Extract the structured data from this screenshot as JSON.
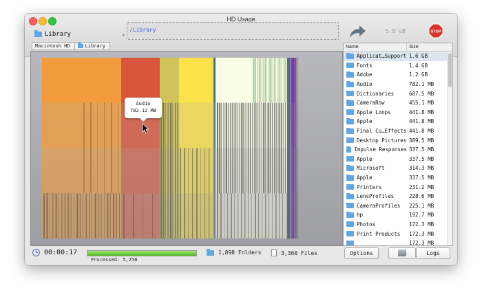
{
  "window": {
    "title": "HD Usage"
  },
  "toolbar": {
    "location_popup": "Library",
    "path": "/Library",
    "total_size": "5.8 GB",
    "stop_label": "STOP"
  },
  "breadcrumb": [
    "Macintosh HD",
    "Library"
  ],
  "tooltip": {
    "name": "Audio",
    "size": "782.12 MB"
  },
  "columns": {
    "name": "Name",
    "size": "Size"
  },
  "items": [
    {
      "name": "Applicat…Support",
      "size": "1.6 GB"
    },
    {
      "name": "Fonts",
      "size": "1.4 GB"
    },
    {
      "name": "Adobe",
      "size": "1.2 GB"
    },
    {
      "name": "Audio",
      "size": "782.1 MB"
    },
    {
      "name": "Dictionaries",
      "size": "687.5 MB"
    },
    {
      "name": "CameraRow",
      "size": "455.1 MB"
    },
    {
      "name": "Apple Loops",
      "size": "441.8 MB"
    },
    {
      "name": "Apple",
      "size": "441.8 MB"
    },
    {
      "name": "Final Cu…Effects",
      "size": "441.8 MB"
    },
    {
      "name": "Desktop Pictures",
      "size": "389.5 MB"
    },
    {
      "name": "Impulse Responses",
      "size": "337.5 MB"
    },
    {
      "name": "Apple",
      "size": "337.5 MB"
    },
    {
      "name": "Microsoft",
      "size": "314.3 MB"
    },
    {
      "name": "Apple",
      "size": "337.5 MB"
    },
    {
      "name": "Printers",
      "size": "231.2 MB"
    },
    {
      "name": "LensProfiles",
      "size": "228.6 MB"
    },
    {
      "name": "CameraProfiles",
      "size": "225.1 MB"
    },
    {
      "name": "hp",
      "size": "192.7 MB"
    },
    {
      "name": "Photos",
      "size": "172.3 MB"
    },
    {
      "name": "Print Products",
      "size": "172.3 MB"
    },
    {
      "name": "",
      "size": "172.3 MB"
    }
  ],
  "status": {
    "elapsed": "00:00:17",
    "progress": 1.0,
    "processed": "Processed: 5,258",
    "folders": "1,898 Folders",
    "files": "3,360 Files"
  },
  "buttons": {
    "options": "Options",
    "logs": "Logs"
  },
  "colors": {
    "orange": "#f19b3c",
    "red": "#d8573c",
    "yellow": "#fce24a",
    "olive": "#d2c45a",
    "cream": "#fafde6",
    "teal": "#3f7488",
    "purple": "#a44fe8",
    "selection": "#dde5f0"
  }
}
